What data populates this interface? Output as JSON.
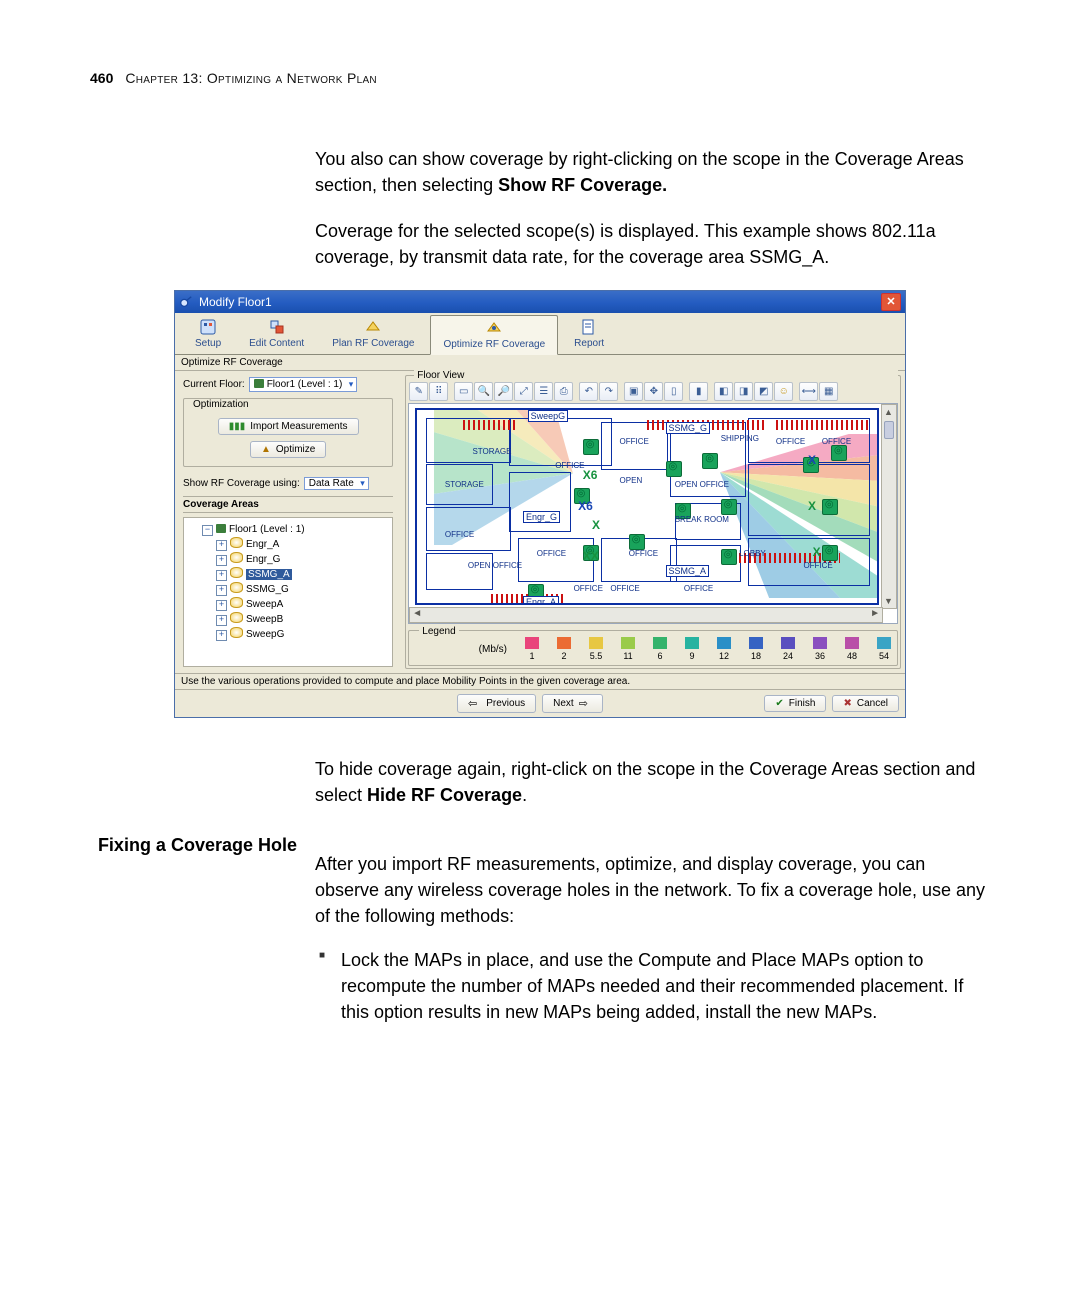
{
  "page": {
    "number": "460",
    "chapter": "Chapter 13: Optimizing a Network Plan"
  },
  "intro_para_pre": "You also can show coverage by right-clicking on the scope in the Coverage Areas section, then selecting ",
  "intro_para_bold": "Show RF Coverage.",
  "intro_para2": "Coverage for the selected scope(s) is displayed. This example shows 802.11a coverage, by transmit data rate, for the coverage area SSMG_A.",
  "hide_para_pre": "To hide coverage again, right-click on the scope in the Coverage Areas section and select ",
  "hide_para_bold": "Hide RF Coverage",
  "hide_para_post": ".",
  "fix": {
    "heading": "Fixing a Coverage Hole",
    "para": "After you import RF measurements, optimize, and display coverage, you can observe any wireless coverage holes in the network. To fix a coverage hole, use any of the following methods:",
    "bullet1": "Lock the MAPs in place, and use the Compute and Place MAPs option to recompute the number of MAPs needed and their recommended placement. If this option results in new MAPs being added, install the new MAPs."
  },
  "win": {
    "title": "Modify Floor1",
    "tabs": {
      "setup": "Setup",
      "edit": "Edit Content",
      "plan": "Plan RF Coverage",
      "opt": "Optimize RF Coverage",
      "report": "Report"
    },
    "section": "Optimize RF Coverage",
    "current_floor_label": "Current Floor:",
    "current_floor_value": "Floor1 (Level : 1)",
    "optimization_label": "Optimization",
    "btn_import": "Import Measurements",
    "btn_optimize": "Optimize",
    "show_label": "Show RF Coverage using:",
    "show_value": "Data Rate",
    "coverageAreasTitle": "Coverage Areas",
    "tree": {
      "root": "Floor1 (Level : 1)",
      "items": [
        {
          "label": "Engr_A"
        },
        {
          "label": "Engr_G"
        },
        {
          "label": "SSMG_A",
          "selected": true
        },
        {
          "label": "SSMG_G"
        },
        {
          "label": "SweepA"
        },
        {
          "label": "SweepB"
        },
        {
          "label": "SweepG"
        }
      ]
    },
    "floor_view_label": "Floor View",
    "tags": {
      "sweepg": "SweepG",
      "ssmg_g": "SSMG_G",
      "engr_g": "Engr_G",
      "ssmg_a": "SSMG_A",
      "engr_a": "Engr_A"
    },
    "fp_labels": [
      "STORAGE",
      "STORAGE",
      "OFFICE",
      "OFFICE",
      "OPEN OFFICE",
      "OFFICE",
      "OFFICE",
      "OPEN OFFICE",
      "OPEN",
      "BREAK ROOM",
      "SHIPPING",
      "OFFICE",
      "OFFICE",
      "OFFICE",
      "OFFICE",
      "OFFICE",
      "OFFICE",
      "LOBBY",
      "OFFICE"
    ],
    "xmarks": [
      "X6",
      "X6",
      "X",
      "X",
      "XX",
      "X",
      "X"
    ],
    "legend_title": "Legend",
    "legend_units": "(Mb/s)",
    "legend": [
      {
        "v": "1",
        "c": "#e9457b"
      },
      {
        "v": "2",
        "c": "#eb6b33"
      },
      {
        "v": "5.5",
        "c": "#e7c742"
      },
      {
        "v": "11",
        "c": "#9acb4a"
      },
      {
        "v": "6",
        "c": "#34b36b"
      },
      {
        "v": "9",
        "c": "#27b3a0"
      },
      {
        "v": "12",
        "c": "#2a8fc7"
      },
      {
        "v": "18",
        "c": "#3663c3"
      },
      {
        "v": "24",
        "c": "#5a4fbf"
      },
      {
        "v": "36",
        "c": "#8a4fbf"
      },
      {
        "v": "48",
        "c": "#b94fa8"
      },
      {
        "v": "54",
        "c": "#3aa4c5"
      }
    ],
    "status": "Use the various operations provided to compute and place Mobility Points in the given coverage area.",
    "buttons": {
      "prev": "Previous",
      "next": "Next",
      "finish": "Finish",
      "cancel": "Cancel"
    }
  }
}
